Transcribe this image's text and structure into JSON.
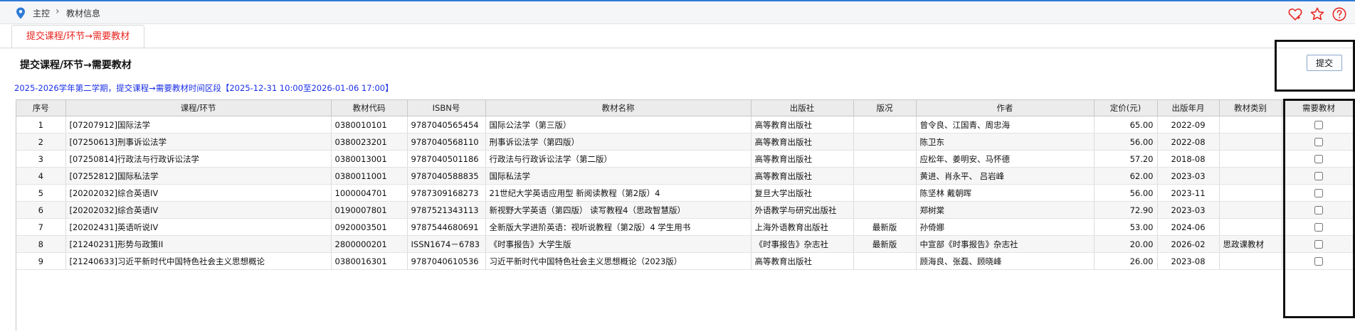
{
  "breadcrumb": {
    "home": "主控",
    "current": "教材信息"
  },
  "tab": {
    "label": "提交课程/环节→需要教材"
  },
  "section": {
    "title": "提交课程/环节→需要教材",
    "submit_label": "提交"
  },
  "period_text": "2025-2026学年第二学期，提交课程→需要教材时间区段【2025-12-31 10:00至2026-01-06 17:00】",
  "colors": {
    "accent": "#2e7bd6",
    "tab_text": "#e8251f",
    "period_text": "#1a2fe6"
  },
  "icons": [
    "location-pin-icon",
    "chevron-right-icon",
    "favorite-heart-icon",
    "star-icon",
    "help-icon"
  ],
  "table": {
    "columns": [
      "序号",
      "课程/环节",
      "教材代码",
      "ISBN号",
      "教材名称",
      "出版社",
      "版况",
      "作者",
      "定价(元)",
      "出版年月",
      "教材类别",
      "需要教材"
    ],
    "rows": [
      [
        "1",
        "[07207912]国际法学",
        "0380010101",
        "9787040565454",
        "国际公法学（第三版）",
        "高等教育出版社",
        "",
        "曾令良、江国青、周忠海",
        "65.00",
        "2022-09",
        ""
      ],
      [
        "2",
        "[07250613]刑事诉讼法学",
        "0380023201",
        "9787040568110",
        "刑事诉讼法学（第四版）",
        "高等教育出版社",
        "",
        "陈卫东",
        "56.00",
        "2022-08",
        ""
      ],
      [
        "3",
        "[07250814]行政法与行政诉讼法学",
        "0380013001",
        "9787040501186",
        "行政法与行政诉讼法学（第二版）",
        "高等教育出版社",
        "",
        "应松年、姜明安、马怀德",
        "57.20",
        "2018-08",
        ""
      ],
      [
        "4",
        "[07252812]国际私法学",
        "0380011001",
        "9787040588835",
        "国际私法学",
        "高等教育出版社",
        "",
        "黄进、肖永平、 吕岩峰",
        "62.00",
        "2023-03",
        ""
      ],
      [
        "5",
        "[20202032]综合英语IV",
        "1000004701",
        "9787309168273",
        "21世纪大学英语应用型 新阅读教程（第2版）4",
        "复旦大学出版社",
        "",
        "陈坚林 戴朝晖",
        "56.00",
        "2023-11",
        ""
      ],
      [
        "6",
        "[20202032]综合英语IV",
        "0190007801",
        "9787521343113",
        "新视野大学英语（第四版） 读写教程4（思政智慧版）",
        "外语教学与研究出版社",
        "",
        "郑树棠",
        "72.90",
        "2023-03",
        ""
      ],
      [
        "7",
        "[20202431]英语听说IV",
        "0920003501",
        "9787544680691",
        "全新版大学进阶英语：视听说教程（第2版）4 学生用书",
        "上海外语教育出版社",
        "最新版",
        "孙倚娜",
        "53.00",
        "2024-06",
        ""
      ],
      [
        "8",
        "[21240231]形势与政策II",
        "2800000201",
        "ISSN1674－6783",
        "《时事报告》大学生版",
        "《时事报告》杂志社",
        "最新版",
        "中宣部《时事报告》杂志社",
        "20.00",
        "2026-02",
        "思政课教材"
      ],
      [
        "9",
        "[21240633]习近平新时代中国特色社会主义思想概论",
        "0380016301",
        "9787040610536",
        "习近平新时代中国特色社会主义思想概论（2023版）",
        "高等教育出版社",
        "",
        "顾海良、张磊、顾晓峰",
        "26.00",
        "2023-08",
        ""
      ]
    ]
  }
}
